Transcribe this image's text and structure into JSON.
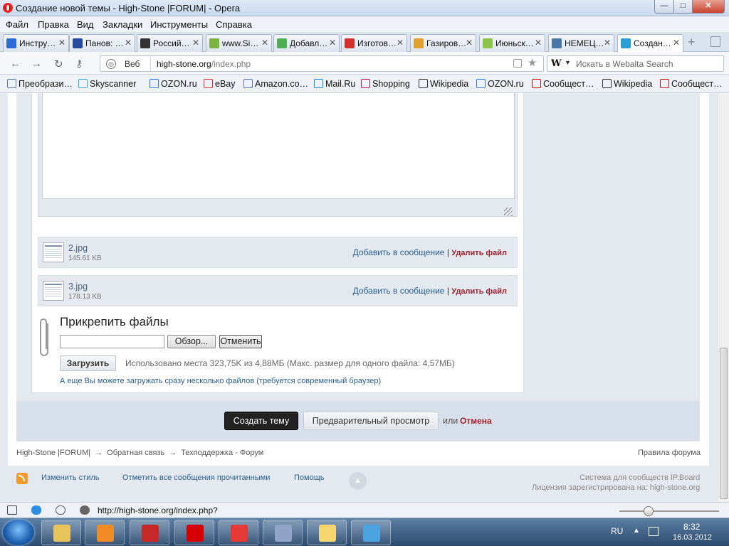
{
  "window": {
    "title": "Создание новой темы - High-Stone |FORUM| - Opera",
    "min": "—",
    "max": "□",
    "close": "✕"
  },
  "menu": [
    "Файл",
    "Правка",
    "Вид",
    "Закладки",
    "Инструменты",
    "Справка"
  ],
  "tabs": [
    {
      "label": "Инстру…",
      "color": "#2d6bd6",
      "active": false
    },
    {
      "label": "Панов: …",
      "color": "#274a9b",
      "active": false
    },
    {
      "label": "Россий…",
      "color": "#333333",
      "active": false
    },
    {
      "label": "www.Si…",
      "color": "#7cb342",
      "active": false
    },
    {
      "label": "Добавл…",
      "color": "#4caf50",
      "active": false
    },
    {
      "label": "Изготов…",
      "color": "#d32f2f",
      "active": false
    },
    {
      "label": "Газиров…",
      "color": "#e0a030",
      "active": false
    },
    {
      "label": "Июньск…",
      "color": "#8bc34a",
      "active": false
    },
    {
      "label": "НЕМЕЦ…",
      "color": "#4a76a8",
      "active": false
    },
    {
      "label": "Создан…",
      "color": "#2a9fd6",
      "active": true
    }
  ],
  "address": {
    "mode": "Веб",
    "url_host": "high-stone.org",
    "url_path": "/index.php",
    "search_placeholder": "Искать в Webalta Search",
    "search_engine_icon": "W"
  },
  "bookmarks": [
    {
      "label": "Преобрази…",
      "icon": "star-icon",
      "color": "#5577aa"
    },
    {
      "label": "Skyscanner",
      "icon": "skyscanner-icon",
      "color": "#3aa6e0"
    },
    {
      "label": "OZON.ru",
      "icon": "ozon-icon",
      "color": "#2d7be0"
    },
    {
      "label": "eBay",
      "icon": "ebay-icon",
      "color": "#e53238"
    },
    {
      "label": "Amazon.co…",
      "icon": "star-icon",
      "color": "#5577aa"
    },
    {
      "label": "Mail.Ru",
      "icon": "mailru-icon",
      "color": "#168de2"
    },
    {
      "label": "Shopping",
      "icon": "shopping-icon",
      "color": "#c2185b"
    },
    {
      "label": "Wikipedia",
      "icon": "wikipedia-icon",
      "color": "#333333"
    },
    {
      "label": "OZON.ru",
      "icon": "ozon-icon",
      "color": "#2d7be0"
    },
    {
      "label": "Сообщест…",
      "icon": "opera-icon",
      "color": "#cc1111"
    },
    {
      "label": "Wikipedia",
      "icon": "wikipedia-icon",
      "color": "#333333"
    },
    {
      "label": "Сообщест…",
      "icon": "opera-icon",
      "color": "#cc1111"
    }
  ],
  "files": [
    {
      "name": "2.jpg",
      "size": "145.61 KB",
      "add": "Добавить в сообщение",
      "sep": "|",
      "delete": "Удалить файл"
    },
    {
      "name": "3.jpg",
      "size": "178.13 KB",
      "add": "Добавить в сообщение",
      "sep": "|",
      "delete": "Удалить файл"
    }
  ],
  "attach": {
    "title": "Прикрепить файлы",
    "browse": "Обзор...",
    "cancel": "Отменить",
    "upload": "Загрузить",
    "usage": "Использовано места 323,75K из 4,88МБ (Макс. размер для одного файла: 4,57МБ)",
    "multi": "А еще Вы можете загружать сразу несколько файлов (требуется современный браузер)"
  },
  "submit": {
    "create": "Создать тему",
    "preview": "Предварительный просмотр",
    "or": "или",
    "cancel": "Отмена"
  },
  "breadcrumb": [
    "High-Stone |FORUM|",
    "Обратная связь",
    "Техподдержка - Форум"
  ],
  "breadcrumb_arrow": "→",
  "rules": "Правила форума",
  "footer": {
    "links": [
      "Изменить стиль",
      "Отметить все сообщения прочитанными",
      "Помощь"
    ],
    "ipb1": "Система для сообществ IP.Board",
    "ipb2": "Лицензия зарегистрирована на: high-stone.org"
  },
  "status": {
    "url": "http://high-stone.org/index.php?"
  },
  "tray": {
    "lang": "RU",
    "time": "8:32",
    "date": "16.03.2012"
  },
  "taskbar_apps": [
    {
      "name": "explorer",
      "color": "#e8c45a"
    },
    {
      "name": "media-player",
      "color": "#f08a24"
    },
    {
      "name": "pokerstars",
      "color": "#c62828"
    },
    {
      "name": "opera",
      "color": "#d50000"
    },
    {
      "name": "poker-chip",
      "color": "#e53935"
    },
    {
      "name": "notepad",
      "color": "#90a4c8"
    },
    {
      "name": "paint",
      "color": "#f5d76e"
    },
    {
      "name": "photo-viewer",
      "color": "#4aa3df"
    }
  ]
}
